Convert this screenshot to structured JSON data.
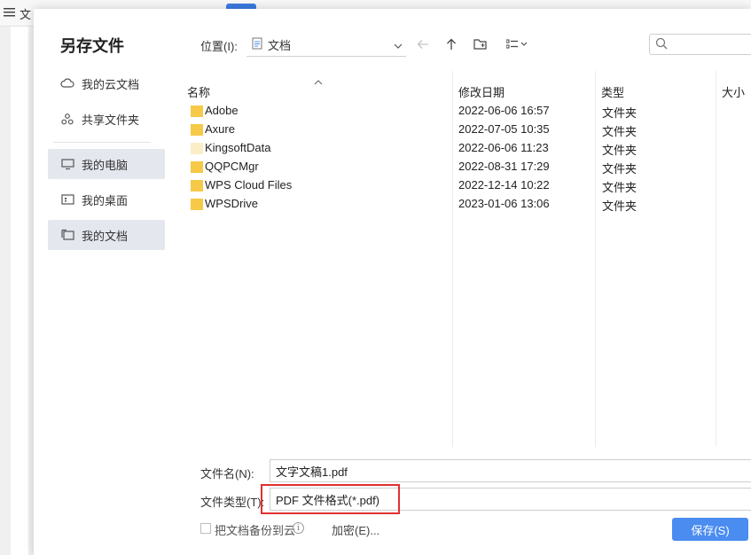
{
  "background": {
    "menu_label": "文"
  },
  "dialog": {
    "title": "另存文件",
    "sidebar": [
      {
        "label": "我的云文档",
        "icon": "cloud-icon"
      },
      {
        "label": "共享文件夹",
        "icon": "share-icon"
      },
      {
        "label": "我的电脑",
        "icon": "computer-icon",
        "active": true
      },
      {
        "label": "我的桌面",
        "icon": "desktop-icon"
      },
      {
        "label": "我的文档",
        "icon": "documents-icon",
        "active": true
      }
    ],
    "location": {
      "label": "位置(I):",
      "value": "文档"
    },
    "search": {
      "placeholder": ""
    },
    "columns": {
      "name": "名称",
      "date": "修改日期",
      "type": "类型",
      "size": "大小"
    },
    "files": [
      {
        "name": "Adobe",
        "date": "2022-06-06 16:57",
        "type": "文件夹"
      },
      {
        "name": "Axure",
        "date": "2022-07-05 10:35",
        "type": "文件夹"
      },
      {
        "name": "KingsoftData",
        "date": "2022-06-06 11:23",
        "type": "文件夹",
        "hidden_style": true
      },
      {
        "name": "QQPCMgr",
        "date": "2022-08-31 17:29",
        "type": "文件夹"
      },
      {
        "name": "WPS Cloud Files",
        "date": "2022-12-14 10:22",
        "type": "文件夹"
      },
      {
        "name": "WPSDrive",
        "date": "2023-01-06 13:06",
        "type": "文件夹"
      }
    ],
    "filename": {
      "label": "文件名(N):",
      "value": "文字文稿1.pdf"
    },
    "filetype": {
      "label": "文件类型(T):",
      "value": "PDF 文件格式(*.pdf)"
    },
    "backup_label": "把文档备份到云",
    "info_glyph": "i",
    "encrypt_label": "加密(E)...",
    "save_label": "保存(S)",
    "colors": {
      "accent": "#4a8cf0",
      "highlight": "#e0312f",
      "folder": "#f7c948"
    }
  }
}
